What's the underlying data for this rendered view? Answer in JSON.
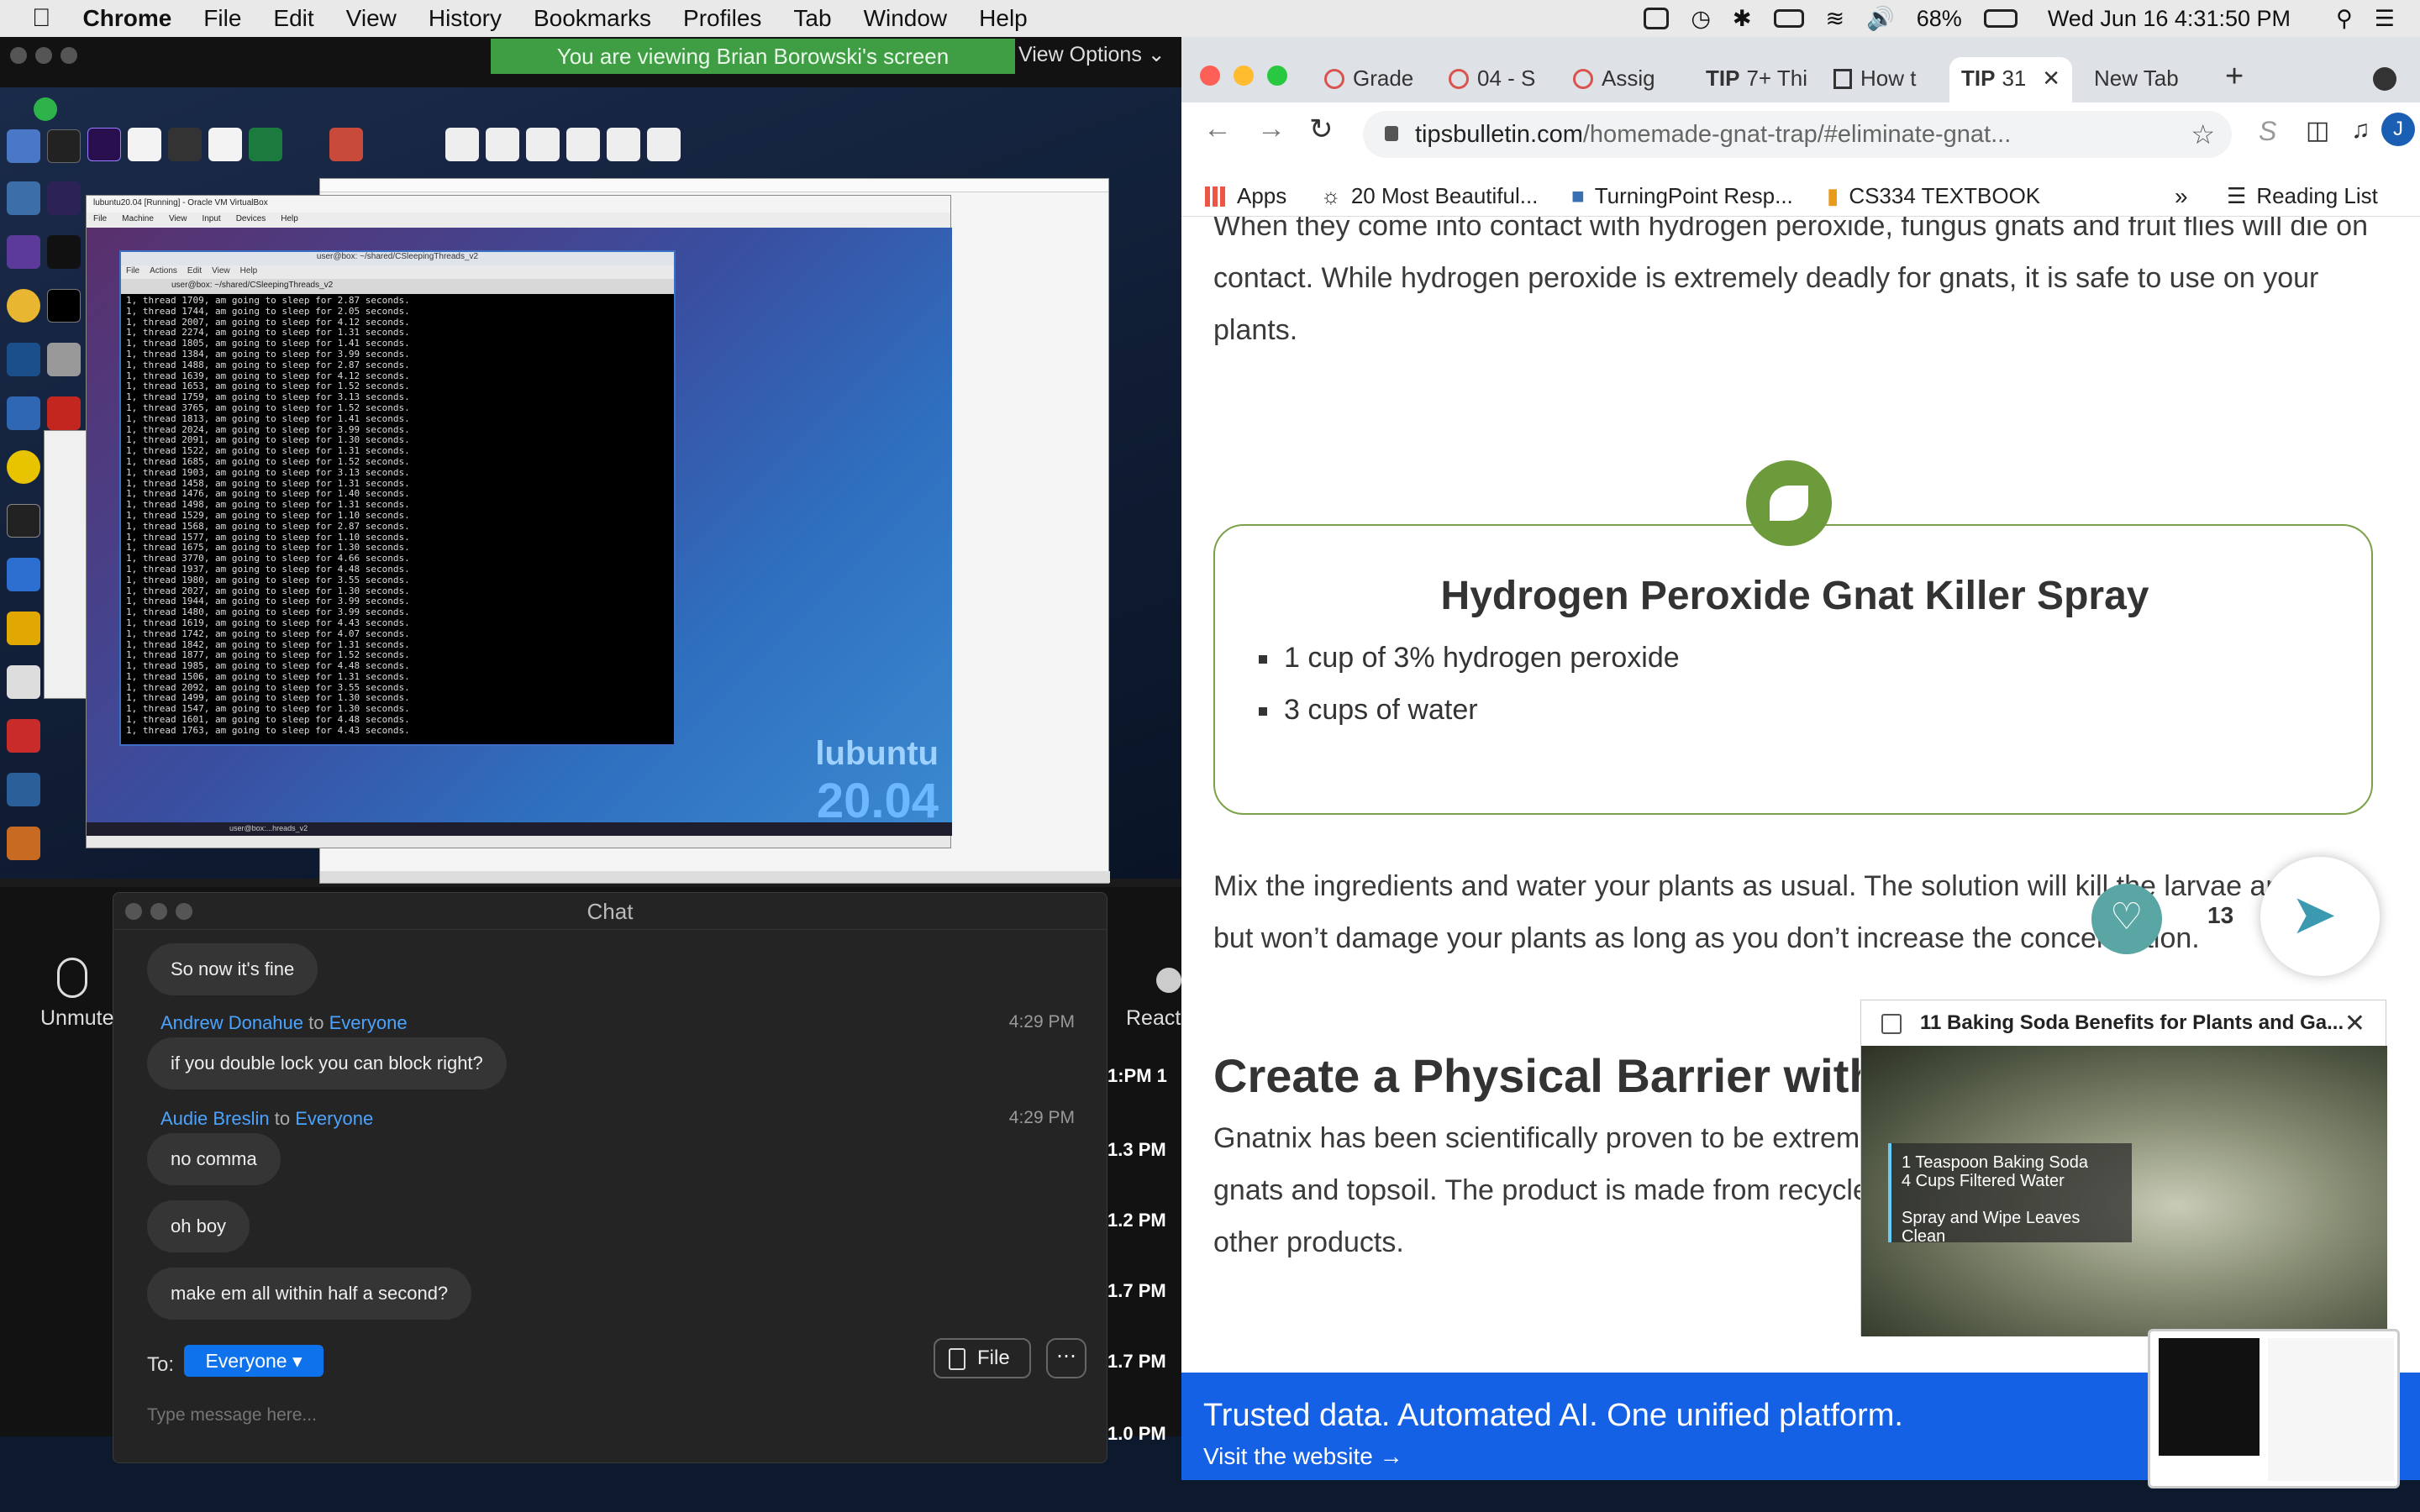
{
  "menubar": {
    "app": "Chrome",
    "items": [
      "File",
      "Edit",
      "View",
      "History",
      "Bookmarks",
      "Profiles",
      "Tab",
      "Window",
      "Help"
    ],
    "battery": "68%",
    "datetime": "Wed Jun 16  4:31:50 PM"
  },
  "zoom": {
    "banner": "You are viewing Brian Borowski's screen",
    "view_options": "View Options",
    "shared_screen": {
      "vbox_title": "lubuntu20.04 [Running] - Oracle VM VirtualBox",
      "vbox_menu": [
        "File",
        "Machine",
        "View",
        "Input",
        "Devices",
        "Help"
      ],
      "term_title": "user@box: ~/shared/CSleepingThreads_v2",
      "term_menu": [
        "File",
        "Actions",
        "Edit",
        "View",
        "Help"
      ],
      "term_tab": "user@box: ~/shared/CSleepingThreads_v2",
      "term_lines": [
        "1, thread 1709, am going to sleep for 2.87 seconds.",
        "1, thread 1744, am going to sleep for 2.05 seconds.",
        "1, thread 2007, am going to sleep for 4.12 seconds.",
        "1, thread 2274, am going to sleep for 1.31 seconds.",
        "1, thread 1805, am going to sleep for 1.41 seconds.",
        "1, thread 1384, am going to sleep for 3.99 seconds.",
        "1, thread 1488, am going to sleep for 2.87 seconds.",
        "1, thread 1639, am going to sleep for 4.12 seconds.",
        "1, thread 1653, am going to sleep for 1.52 seconds.",
        "1, thread 1759, am going to sleep for 3.13 seconds.",
        "1, thread 3765, am going to sleep for 1.52 seconds.",
        "1, thread 1813, am going to sleep for 1.41 seconds.",
        "1, thread 2024, am going to sleep for 3.99 seconds.",
        "1, thread 2091, am going to sleep for 1.30 seconds.",
        "1, thread 1522, am going to sleep for 1.31 seconds.",
        "1, thread 1685, am going to sleep for 1.52 seconds.",
        "1, thread 1903, am going to sleep for 3.13 seconds.",
        "1, thread 1458, am going to sleep for 1.31 seconds.",
        "1, thread 1476, am going to sleep for 1.40 seconds.",
        "1, thread 1498, am going to sleep for 1.31 seconds.",
        "1, thread 1529, am going to sleep for 1.10 seconds.",
        "1, thread 1568, am going to sleep for 2.87 seconds.",
        "1, thread 1577, am going to sleep for 1.10 seconds.",
        "1, thread 1675, am going to sleep for 1.30 seconds.",
        "1, thread 3770, am going to sleep for 4.66 seconds.",
        "1, thread 1937, am going to sleep for 4.48 seconds.",
        "1, thread 1980, am going to sleep for 3.55 seconds.",
        "1, thread 2027, am going to sleep for 1.30 seconds.",
        "1, thread 1944, am going to sleep for 3.99 seconds.",
        "1, thread 1480, am going to sleep for 3.99 seconds.",
        "1, thread 1619, am going to sleep for 4.43 seconds.",
        "1, thread 1742, am going to sleep for 4.07 seconds.",
        "1, thread 1842, am going to sleep for 1.31 seconds.",
        "1, thread 1877, am going to sleep for 1.52 seconds.",
        "1, thread 1985, am going to sleep for 4.48 seconds.",
        "1, thread 1506, am going to sleep for 1.31 seconds.",
        "1, thread 2092, am going to sleep for 3.55 seconds.",
        "1, thread 1499, am going to sleep for 1.30 seconds.",
        "1, thread 1547, am going to sleep for 1.30 seconds.",
        "1, thread 1601, am going to sleep for 4.48 seconds.",
        "1, thread 1763, am going to sleep for 4.43 seconds."
      ],
      "lubuntu": "lubuntu",
      "lubuntu_version": "20.04",
      "vm_taskbar": "user@box:...hreads_v2"
    },
    "chat": {
      "title": "Chat",
      "messages": [
        {
          "text": "So now it's fine"
        },
        {
          "sender": "Andrew Donahue",
          "to": "to",
          "recipient": "Everyone",
          "time": "4:29 PM",
          "text": "if you double lock you can block right?"
        },
        {
          "sender": "Audie Breslin",
          "to": "to",
          "recipient": "Everyone",
          "time": "4:29 PM",
          "text": "no comma"
        },
        {
          "text": "oh boy"
        },
        {
          "text": "make em all within half a second?"
        }
      ],
      "to_label": "To:",
      "everyone": "Everyone",
      "file": "File",
      "more": "⋯",
      "placeholder": "Type message here..."
    },
    "controls": {
      "unmute": "Unmute",
      "react": "React"
    },
    "side_times": [
      "1:PM 1",
      "1.3 PM",
      "1.2 PM",
      "1.7 PM",
      "1.7 PM",
      "1.0 PM"
    ]
  },
  "chrome": {
    "tabs": [
      "Grade",
      "04 - S",
      "Assig",
      "7+ Thi",
      "How t",
      "31",
      "New Tab"
    ],
    "url_host": "tipsbulletin.com",
    "url_path": "/homemade-gnat-trap/#eliminate-gnat...",
    "profile_initial": "J",
    "bookmarks": [
      "Apps",
      "20 Most Beautiful...",
      "TurningPoint Resp...",
      "CS334 TEXTBOOK"
    ],
    "reading_list": "Reading List",
    "article": {
      "para1": "When they come into contact with hydrogen peroxide, fungus gnats and fruit flies will die on contact. While hydrogen peroxide is extremely deadly for gnats, it is safe to use on your plants.",
      "recipe_title": "Hydrogen Peroxide Gnat Killer Spray",
      "ingredients": [
        "1 cup of 3% hydrogen peroxide",
        "3 cups of water"
      ],
      "para2": "Mix the ingredients and water your plants as usual. The solution will kill the larvae and eggs but won’t damage your plants as long as you don’t increase the concentration.",
      "heading": "Create a Physical Barrier with",
      "para3": "Gnatnix has been scientifically proven to be extremely effective at creating a barrier between gnats and topsoil. The product is made from recycled glass and is a non-toxic alternative to other products."
    },
    "share_count": "13",
    "video": {
      "title": "11 Baking Soda Benefits for Plants and Ga...",
      "caption1": "1 Teaspoon Baking Soda",
      "caption2": "4 Cups Filtered Water",
      "caption3": "Spray and Wipe Leaves Clean"
    },
    "ad": {
      "title": "Trusted data. Automated AI. One unified platform.",
      "link": "Visit the website →"
    }
  },
  "colors": {
    "zoom_green": "#3f9d43",
    "link_blue": "#4aa3ff",
    "recipe_green": "#7ba24a",
    "ad_blue": "#1561e6"
  }
}
